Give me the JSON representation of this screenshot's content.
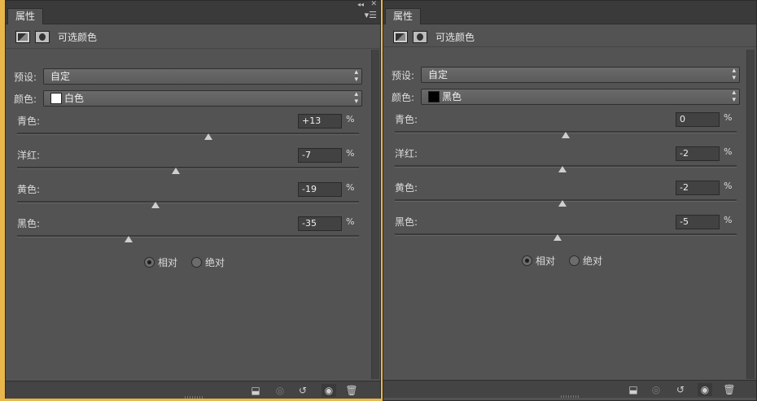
{
  "colors": {
    "panel_bg": "#535353",
    "dark_bar": "#3a3a3a",
    "highlight": "#e8b64a"
  },
  "panels": [
    {
      "tab_label": "属性",
      "title": "可选颜色",
      "preset_label": "预设:",
      "preset_value": "自定",
      "color_label": "颜色:",
      "color_value": "白色",
      "color_swatch": "#ffffff",
      "sliders": [
        {
          "label": "青色:",
          "value": "+13",
          "unit": "%",
          "percent_position": 0.56
        },
        {
          "label": "洋红:",
          "value": "-7",
          "unit": "%",
          "percent_position": 0.465
        },
        {
          "label": "黄色:",
          "value": "-19",
          "unit": "%",
          "percent_position": 0.405
        },
        {
          "label": "黑色:",
          "value": "-35",
          "unit": "%",
          "percent_position": 0.325
        }
      ],
      "radio_relative": "相对",
      "radio_absolute": "绝对",
      "relative_checked": true
    },
    {
      "tab_label": "属性",
      "title": "可选颜色",
      "preset_label": "预设:",
      "preset_value": "自定",
      "color_label": "颜色:",
      "color_value": "黑色",
      "color_swatch": "#000000",
      "sliders": [
        {
          "label": "青色:",
          "value": "0",
          "unit": "%",
          "percent_position": 0.5
        },
        {
          "label": "洋红:",
          "value": "-2",
          "unit": "%",
          "percent_position": 0.49
        },
        {
          "label": "黄色:",
          "value": "-2",
          "unit": "%",
          "percent_position": 0.49
        },
        {
          "label": "黑色:",
          "value": "-5",
          "unit": "%",
          "percent_position": 0.475
        }
      ],
      "radio_relative": "相对",
      "radio_absolute": "绝对",
      "relative_checked": true
    }
  ],
  "icons": {
    "collapse": "double-chevron-left-icon",
    "close": "close-icon",
    "menu": "panel-menu-icon",
    "clip": "clip-to-layer-icon",
    "view_previous": "view-previous-state-icon",
    "reset": "reset-icon",
    "visibility": "eye-icon",
    "delete": "trash-icon"
  }
}
